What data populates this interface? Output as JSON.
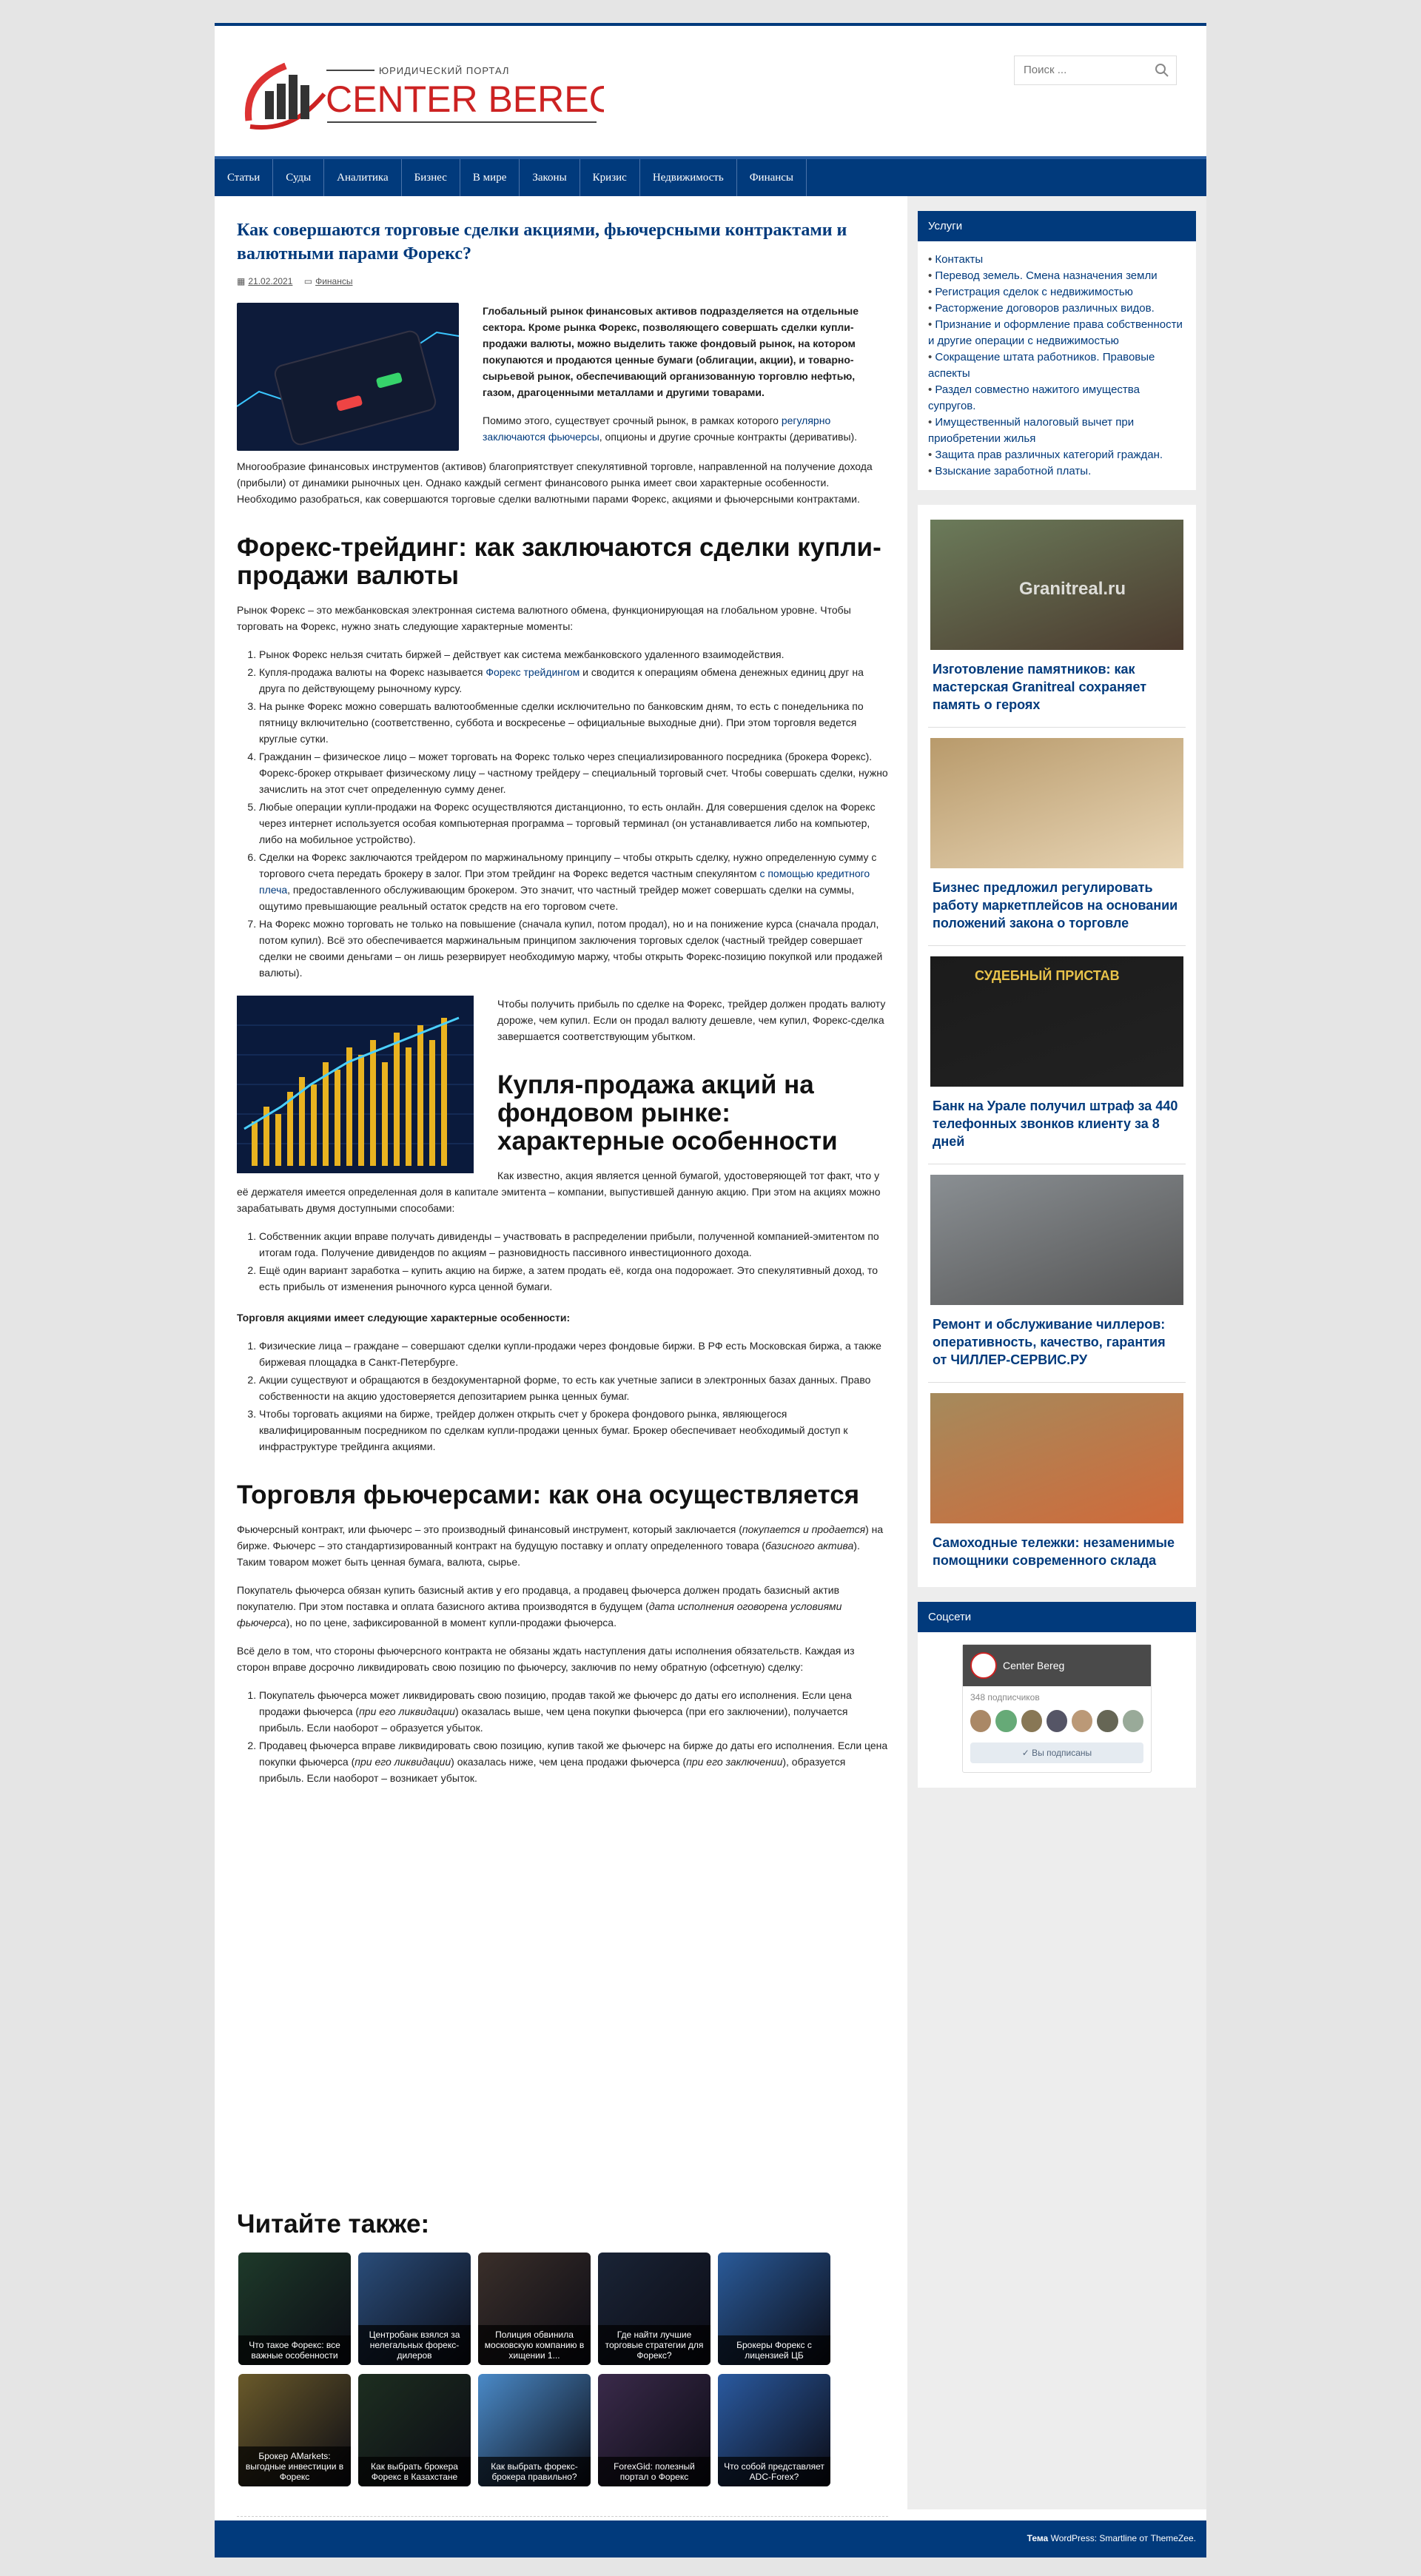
{
  "header": {
    "logo_top": "ЮРИДИЧЕСКИЙ ПОРТАЛ",
    "logo_name": "CENTER BEREG",
    "search_placeholder": "Поиск ..."
  },
  "nav": [
    "Статьи",
    "Суды",
    "Аналитика",
    "Бизнес",
    "В мире",
    "Законы",
    "Кризис",
    "Недвижимость",
    "Финансы"
  ],
  "article": {
    "title": "Как совершаются торговые сделки акциями, фьючерсными контрактами и валютными парами Форекс?",
    "date": "21.02.2021",
    "category": "Финансы",
    "lead": "Глобальный рынок финансовых активов подразделяется на отдельные сектора. Кроме рынка Форекс, позволяющего совершать сделки купли-продажи валюты, можно выделить также фондовый рынок, на котором покупаются и продаются ценные бумаги (облигации, акции), и товарно-сырьевой рынок, обеспечивающий организованную торговлю нефтью, газом, драгоценными металлами и другими товарами.",
    "p2_a": "Помимо этого, существует срочный рынок, в рамках которого ",
    "p2_link": "регулярно заключаются фьючерсы",
    "p2_b": ", опционы и другие срочные контракты (деривативы).",
    "p3": "Многообразие финансовых инструментов (активов) благоприятствует спекулятивной торговле, направленной на получение дохода (прибыли) от динамики рыночных цен. Однако каждый сегмент финансового рынка имеет свои характерные особенности. Необходимо разобраться, как совершаются торговые сделки валютными парами Форекс, акциями и фьючерсными контрактами.",
    "h2_1": "Форекс-трейдинг: как заключаются сделки купли-продажи валюты",
    "p4": "Рынок Форекс – это межбанковская электронная система валютного обмена, функционирующая на глобальном уровне. Чтобы торговать на Форекс, нужно знать следующие характерные моменты:",
    "forex_list": [
      "Рынок Форекс нельзя считать биржей – действует как система межбанковского удаленного взаимодействия.",
      "Купля-продажа валюты на Форекс называется |Форекс трейдингом| и сводится к операциям обмена денежных единиц друг на друга по действующему рыночному курсу.",
      "На рынке Форекс можно совершать валютообменные сделки исключительно по банковским дням, то есть с понедельника по пятницу включительно (соответственно, суббота и воскресенье – официальные выходные дни). При этом торговля ведется круглые сутки.",
      "Гражданин – физическое лицо – может торговать на Форекс только через специализированного посредника (брокера Форекс). Форекс-брокер открывает физическому лицу – частному трейдеру – специальный торговый счет. Чтобы совершать сделки, нужно зачислить на этот счет определенную сумму денег.",
      "Любые операции купли-продажи на Форекс осуществляются дистанционно, то есть онлайн. Для совершения сделок на Форекс через интернет используется особая компьютерная программа – торговый терминал (он устанавливается либо на компьютер, либо на мобильное устройство).",
      "Сделки на Форекс заключаются трейдером по маржинальному принципу – чтобы открыть сделку, нужно определенную сумму с торгового счета передать брокеру в залог. При этом трейдинг на Форекс ведется частным спекулянтом |с помощью кредитного плеча|, предоставленного обслуживающим брокером. Это значит, что частный трейдер может совершать сделки на суммы, ощутимо превышающие реальный остаток средств на его торговом счете.",
      "На Форекс можно торговать не только на повышение (сначала купил, потом продал), но и на понижение курса (сначала продал, потом купил). Всё это обеспечивается маржинальным принципом заключения торговых сделок (частный трейдер совершает сделки не своими деньгами – он лишь резервирует необходимую маржу, чтобы открыть Форекс-позицию покупкой или продажей валюты)."
    ],
    "p5": "Чтобы получить прибыль по сделке на Форекс, трейдер должен продать валюту дороже, чем купил. Если он продал валюту дешевле, чем купил, Форекс-сделка завершается соответствующим убытком.",
    "h2_2": "Купля-продажа акций на фондовом рынке: характерные особенности",
    "p6": "Как известно, акция является ценной бумагой, удостоверяющей тот факт, что у её держателя имеется определенная доля в капитале эмитента – компании, выпустившей данную акцию. При этом на акциях можно зарабатывать двумя доступными способами:",
    "stock_list": [
      "Собственник акции вправе получать дивиденды – участвовать в распределении прибыли, полученной компанией-эмитентом по итогам года. Получение дивидендов по акциям – разновидность пассивного инвестиционного дохода.",
      "Ещё один вариант заработка – купить акцию на бирже, а затем продать её, когда она подорожает. Это спекулятивный доход, то есть прибыль от изменения рыночного курса ценной бумаги."
    ],
    "p7": "Торговля акциями имеет следующие характерные особенности:",
    "stock_list2": [
      "Физические лица – граждане – совершают сделки купли-продажи через фондовые биржи. В РФ есть Московская биржа, а также биржевая площадка в Санкт-Петербурге.",
      "Акции существуют и обращаются в бездокументарной форме, то есть как учетные записи в электронных базах данных. Право собственности на акцию удостоверяется депозитарием рынка ценных бумаг.",
      "Чтобы торговать акциями на бирже, трейдер должен открыть счет у брокера фондового рынка, являющегося квалифицированным посредником по сделкам купли-продажи ценных бумаг. Брокер обеспечивает необходимый доступ к инфраструктуре трейдинга акциями."
    ],
    "h2_3": "Торговля фьючерсами: как она осуществляется",
    "p8_a": "Фьючерсный контракт, или фьючерс – это производный финансовый инструмент, который заключается (",
    "p8_i1": "покупается и продается",
    "p8_b": ") на бирже. Фьючерс – это стандартизированный контракт на будущую поставку и оплату определенного товара (",
    "p8_i2": "базисного актива",
    "p8_c": "). Таким товаром может быть ценная бумага, валюта, сырье.",
    "p9_a": "Покупатель фьючерса обязан купить базисный актив у его продавца, а продавец фьючерса должен продать базисный актив покупателю. При этом поставка и оплата базисного актива производятся в будущем (",
    "p9_i": "дата исполнения оговорена условиями фьючерса",
    "p9_b": "), но по цене, зафиксированной в момент купли-продажи фьючерса.",
    "p10": "Всё дело в том, что стороны фьючерсного контракта не обязаны ждать наступления даты исполнения обязательств. Каждая из сторон вправе досрочно ликвидировать свою позицию по фьючерсу, заключив по нему обратную (офсетную) сделку:",
    "fut_1a": "Покупатель фьючерса может ликвидировать свою позицию, продав такой же фьючерс до даты его исполнения. Если цена продажи фьючерса (",
    "fut_1i": "при его ликвидации",
    "fut_1b": ") оказалась выше, чем цена покупки фьючерса (при его заключении), получается прибыль. Если наоборот – образуется убыток.",
    "fut_2a": "Продавец фьючерса вправе ликвидировать свою позицию, купив такой же фьючерс на бирже до даты его исполнения. Если цена покупки фьючерса (",
    "fut_2i": "при его ликвидации",
    "fut_2b": ") оказалась ниже, чем цена продажи фьючерса (",
    "fut_2i2": "при его заключении",
    "fut_2c": "), образуется прибыль. Если наоборот – возникает убыток."
  },
  "read_also": {
    "title": "Читайте также:",
    "items": [
      "Что такое Форекс: все важные особенности",
      "Центробанк взялся за нелегальных форекс-дилеров",
      "Полиция обвинила московскую компанию в хищении 1...",
      "Где найти лучшие торговые стратегии для Форекс?",
      "Брокеры Форекс с лицензией ЦБ",
      "Брокер AMarkets: выгодные инвестиции в Форекс",
      "Как выбрать брокера Форекс в Казахстане",
      "Как выбрать форекс-брокера правильно?",
      "ForexGid: полезный портал о Форекс",
      "Что собой представляет ADC-Forex?"
    ]
  },
  "sidebar": {
    "services_title": "Услуги",
    "services": [
      "Контакты",
      "Перевод земель. Смена назначения земли",
      "Регистрация сделок с недвижимостью",
      "Расторжение договоров различных видов.",
      "Признание и оформление права собственности и другие операции с недвижимостью",
      "Сокращение штата работников. Правовые аспекты",
      "Раздел совместно нажитого имущества супругов.",
      "Имущественный налоговый вычет при приобретении жилья",
      "Защита прав различных категорий граждан.",
      "Взыскание заработной платы."
    ],
    "cards": [
      "Изготовление памятников: как мастерская Granitreal сохраняет память о героях",
      "Бизнес предложил регулировать работу маркетплейсов на основании положений закона о торговле",
      "Банк на Урале получил штраф за 440 телефонных звонков клиенту за 8 дней",
      "Ремонт и обслуживание чиллеров: оперативность, качество, гарантия от ЧИЛЛЕР-СЕРВИС.РУ",
      "Самоходные тележки: незаменимые помощники современного склада"
    ],
    "card1_watermark": "Granitreal.ru",
    "card3_badge": "СУДЕБНЫЙ ПРИСТАВ",
    "social_title": "Соцсети",
    "vk_name": "Center Bereg",
    "vk_subs": "348 подписчиков",
    "vk_btn": "✓  Вы подписаны"
  },
  "footer": {
    "text_a": "Тема ",
    "text_b": "WordPress: Smartline от ThemeZee."
  }
}
